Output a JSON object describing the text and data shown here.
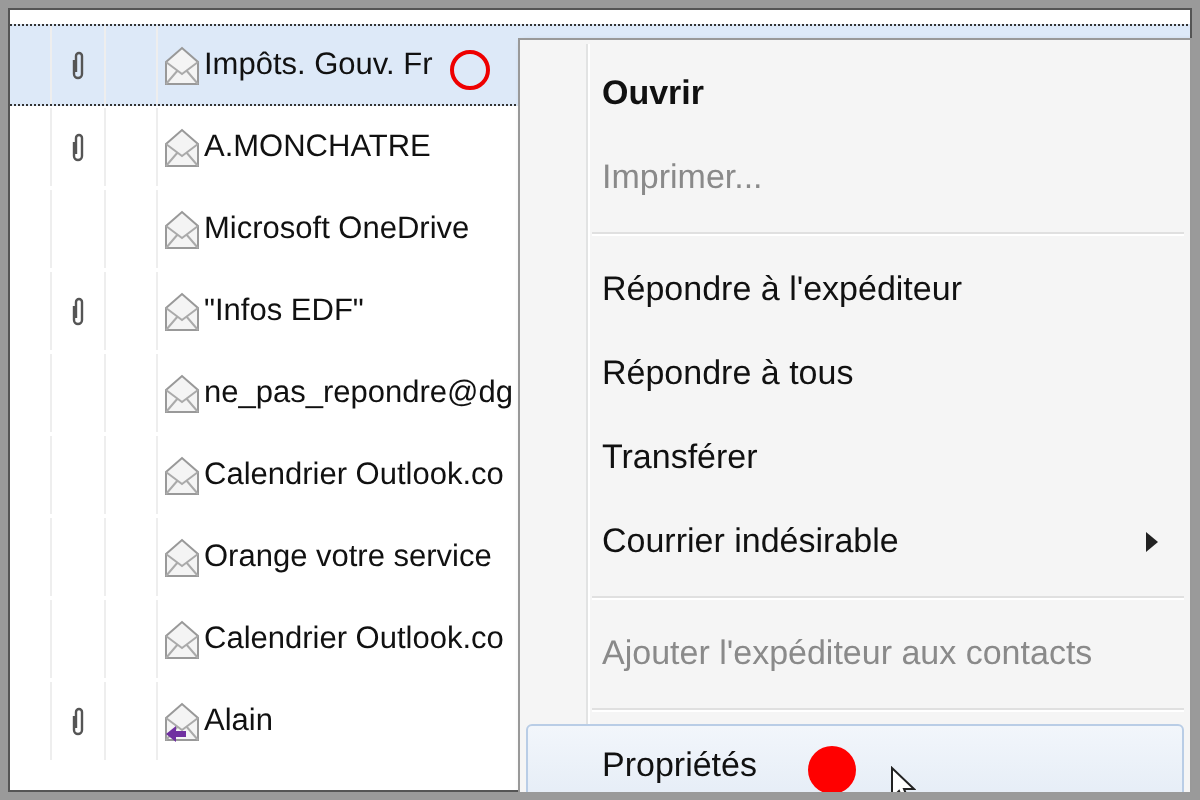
{
  "messages": [
    {
      "sender": "Impôts. Gouv. Fr",
      "attachment": true,
      "replied": false,
      "selected": true
    },
    {
      "sender": "A.MONCHATRE",
      "attachment": true,
      "replied": false,
      "selected": false
    },
    {
      "sender": "Microsoft OneDrive",
      "attachment": false,
      "replied": false,
      "selected": false
    },
    {
      "sender": "\"Infos EDF\"",
      "attachment": true,
      "replied": false,
      "selected": false
    },
    {
      "sender": "ne_pas_repondre@dg",
      "attachment": false,
      "replied": false,
      "selected": false
    },
    {
      "sender": "Calendrier Outlook.co",
      "attachment": false,
      "replied": false,
      "selected": false
    },
    {
      "sender": "Orange votre service",
      "attachment": false,
      "replied": false,
      "selected": false
    },
    {
      "sender": "Calendrier Outlook.co",
      "attachment": false,
      "replied": false,
      "selected": false
    },
    {
      "sender": "Alain",
      "attachment": true,
      "replied": true,
      "selected": false
    }
  ],
  "context_menu": {
    "items": [
      {
        "kind": "item",
        "label": "Ouvrir",
        "default": true,
        "disabled": false,
        "submenu": false,
        "hovered": false
      },
      {
        "kind": "item",
        "label": "Imprimer...",
        "default": false,
        "disabled": true,
        "submenu": false,
        "hovered": false
      },
      {
        "kind": "separator"
      },
      {
        "kind": "item",
        "label": "Répondre à l'expéditeur",
        "default": false,
        "disabled": false,
        "submenu": false,
        "hovered": false
      },
      {
        "kind": "item",
        "label": "Répondre à tous",
        "default": false,
        "disabled": false,
        "submenu": false,
        "hovered": false
      },
      {
        "kind": "item",
        "label": "Transférer",
        "default": false,
        "disabled": false,
        "submenu": false,
        "hovered": false
      },
      {
        "kind": "item",
        "label": "Courrier indésirable",
        "default": false,
        "disabled": false,
        "submenu": true,
        "hovered": false
      },
      {
        "kind": "separator"
      },
      {
        "kind": "item",
        "label": "Ajouter l'expéditeur aux contacts",
        "default": false,
        "disabled": true,
        "submenu": false,
        "hovered": false
      },
      {
        "kind": "separator"
      },
      {
        "kind": "item",
        "label": "Propriétés",
        "default": false,
        "disabled": false,
        "submenu": false,
        "hovered": true
      }
    ]
  }
}
